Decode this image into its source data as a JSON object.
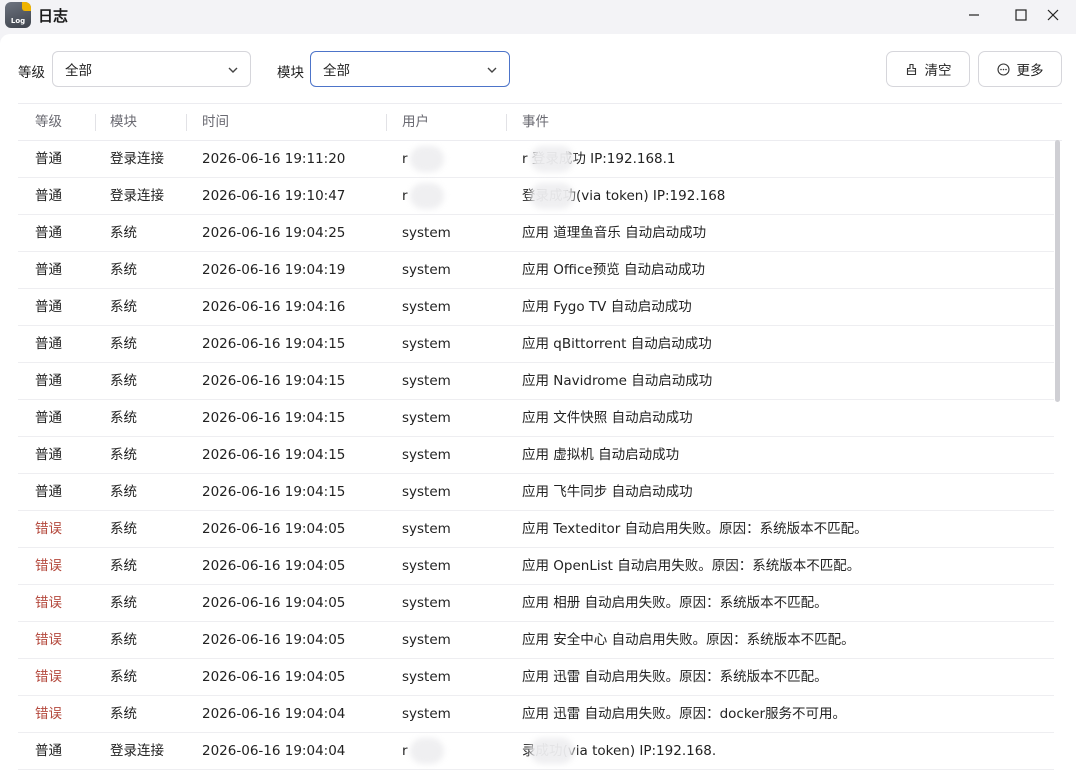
{
  "window": {
    "title": "日志",
    "app_icon_text": "Log"
  },
  "filters": {
    "level_label": "等级",
    "level_value": "全部",
    "module_label": "模块",
    "module_value": "全部",
    "clear_label": "清空",
    "more_label": "更多"
  },
  "table": {
    "headers": [
      "等级",
      "模块",
      "时间",
      "用户",
      "事件"
    ],
    "rows": [
      {
        "level": "普通",
        "module": "登录连接",
        "time": "2026-06-16 19:11:20",
        "user": "r",
        "event": "r       登录成功 IP:192.168.1",
        "error": false,
        "blur_user": true,
        "blur_event": true
      },
      {
        "level": "普通",
        "module": "登录连接",
        "time": "2026-06-16 19:10:47",
        "user": "r",
        "event": "           登录成功(via token) IP:192.168",
        "error": false,
        "blur_user": true,
        "blur_event": true
      },
      {
        "level": "普通",
        "module": "系统",
        "time": "2026-06-16 19:04:25",
        "user": "system",
        "event": "应用 道理鱼音乐 自动启动成功",
        "error": false
      },
      {
        "level": "普通",
        "module": "系统",
        "time": "2026-06-16 19:04:19",
        "user": "system",
        "event": "应用 Office预览 自动启动成功",
        "error": false
      },
      {
        "level": "普通",
        "module": "系统",
        "time": "2026-06-16 19:04:16",
        "user": "system",
        "event": "应用 Fygo TV 自动启动成功",
        "error": false
      },
      {
        "level": "普通",
        "module": "系统",
        "time": "2026-06-16 19:04:15",
        "user": "system",
        "event": "应用 qBittorrent 自动启动成功",
        "error": false
      },
      {
        "level": "普通",
        "module": "系统",
        "time": "2026-06-16 19:04:15",
        "user": "system",
        "event": "应用 Navidrome 自动启动成功",
        "error": false
      },
      {
        "level": "普通",
        "module": "系统",
        "time": "2026-06-16 19:04:15",
        "user": "system",
        "event": "应用 文件快照 自动启动成功",
        "error": false
      },
      {
        "level": "普通",
        "module": "系统",
        "time": "2026-06-16 19:04:15",
        "user": "system",
        "event": "应用 虚拟机 自动启动成功",
        "error": false
      },
      {
        "level": "普通",
        "module": "系统",
        "time": "2026-06-16 19:04:15",
        "user": "system",
        "event": "应用 飞牛同步 自动启动成功",
        "error": false
      },
      {
        "level": "错误",
        "module": "系统",
        "time": "2026-06-16 19:04:05",
        "user": "system",
        "event": "应用 Texteditor 自动启用失败。原因：系统版本不匹配。",
        "error": true
      },
      {
        "level": "错误",
        "module": "系统",
        "time": "2026-06-16 19:04:05",
        "user": "system",
        "event": "应用 OpenList 自动启用失败。原因：系统版本不匹配。",
        "error": true
      },
      {
        "level": "错误",
        "module": "系统",
        "time": "2026-06-16 19:04:05",
        "user": "system",
        "event": "应用 相册 自动启用失败。原因：系统版本不匹配。",
        "error": true
      },
      {
        "level": "错误",
        "module": "系统",
        "time": "2026-06-16 19:04:05",
        "user": "system",
        "event": "应用 安全中心 自动启用失败。原因：系统版本不匹配。",
        "error": true
      },
      {
        "level": "错误",
        "module": "系统",
        "time": "2026-06-16 19:04:05",
        "user": "system",
        "event": "应用 迅雷 自动启用失败。原因：系统版本不匹配。",
        "error": true
      },
      {
        "level": "错误",
        "module": "系统",
        "time": "2026-06-16 19:04:04",
        "user": "system",
        "event": "应用 迅雷 自动启用失败。原因：docker服务不可用。",
        "error": true
      },
      {
        "level": "普通",
        "module": "登录连接",
        "time": "2026-06-16 19:04:04",
        "user": "r",
        "event": "             录成功(via token) IP:192.168.",
        "error": false,
        "blur_user": true,
        "blur_event": true
      }
    ]
  },
  "colors": {
    "error_text": "#b4493d",
    "active_border": "#4d74c9",
    "app_bg": "#f3f3f6"
  },
  "icons": {
    "clear": "broom-icon",
    "more": "more-circle-icon",
    "minimize": "minimize-icon",
    "maximize": "maximize-icon",
    "close": "close-icon",
    "dropdown": "chevron-down-icon"
  }
}
